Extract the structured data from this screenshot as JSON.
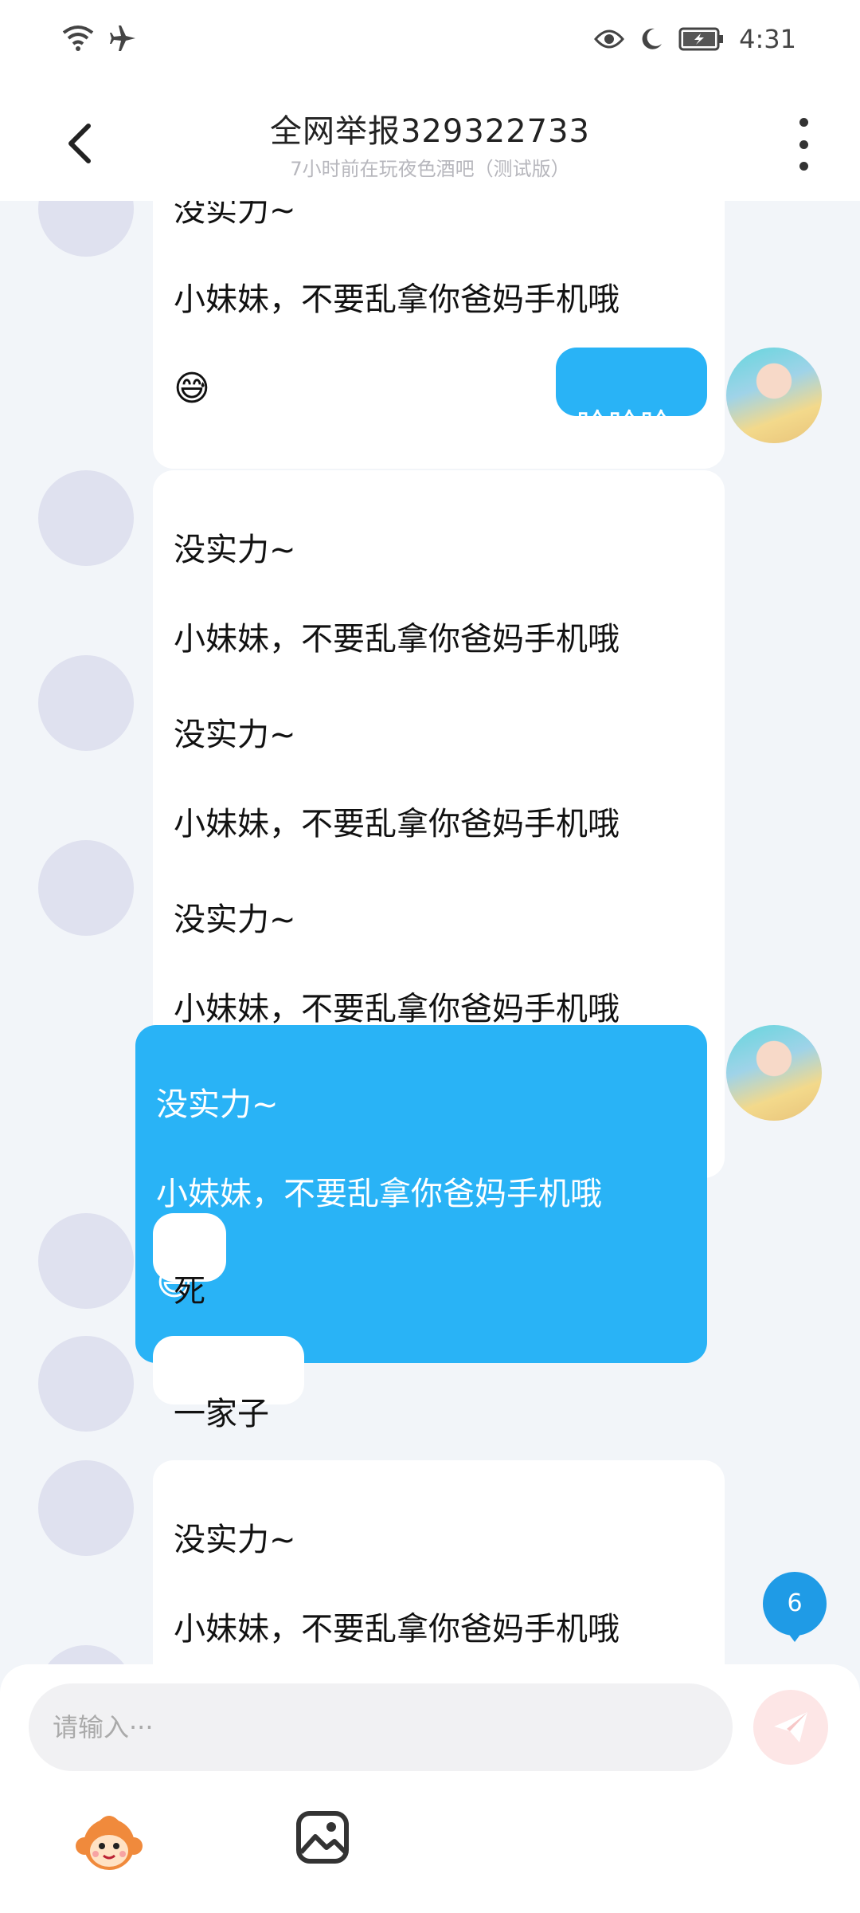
{
  "status_bar": {
    "time": "4:31"
  },
  "header": {
    "title": "全网举报329322733",
    "subtitle": "7小时前在玩夜色酒吧（测试版）"
  },
  "messages": [
    {
      "side": "left",
      "line1": "没实力~",
      "line2": "小妹妹，不要乱拿你爸妈手机哦",
      "emoji": "😅"
    },
    {
      "side": "right",
      "text": "哈哈哈"
    },
    {
      "side": "left",
      "line1": "没实力~",
      "line2": "小妹妹，不要乱拿你爸妈手机哦",
      "emoji": "😅"
    },
    {
      "side": "left",
      "line1": "没实力~",
      "line2": "小妹妹，不要乱拿你爸妈手机哦",
      "emoji": "😅"
    },
    {
      "side": "left",
      "line1": "没实力~",
      "line2": "小妹妹，不要乱拿你爸妈手机哦",
      "emoji": "😅"
    },
    {
      "side": "right",
      "line1": "没实力~",
      "line2": "小妹妹，不要乱拿你爸妈手机哦",
      "emoji": "😅"
    },
    {
      "side": "left",
      "text": "死"
    },
    {
      "side": "left",
      "text": "一家子"
    },
    {
      "side": "left",
      "line1": "没实力~",
      "line2": "小妹妹，不要乱拿你爸妈手机哦",
      "emoji": "😅"
    }
  ],
  "unread_badge": "6",
  "composer": {
    "placeholder": "请输入···"
  },
  "colors": {
    "accent": "#29b3f6",
    "background": "#f2f5f9"
  }
}
